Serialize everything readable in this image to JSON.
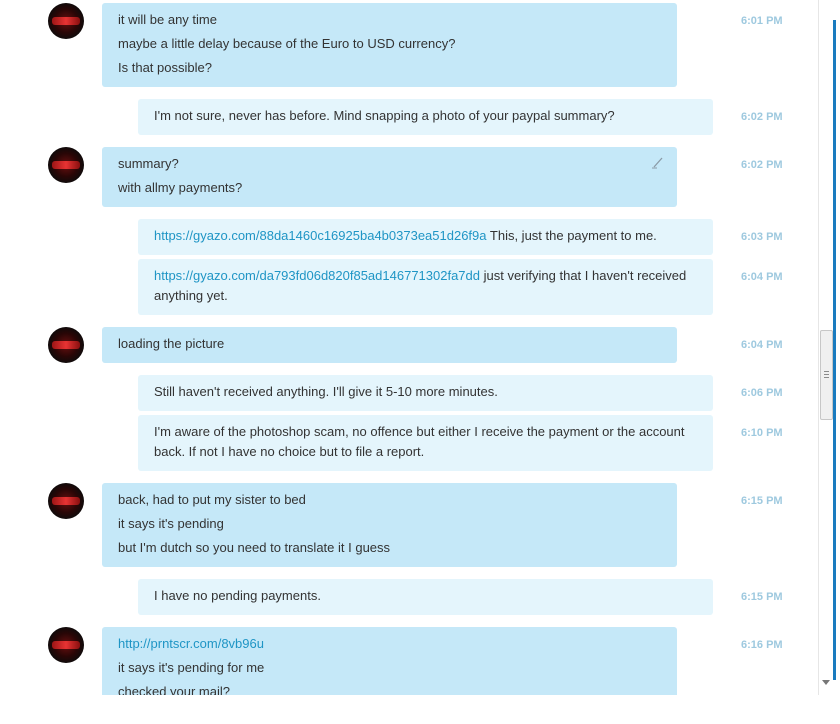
{
  "messages": [
    {
      "sender": "them",
      "lines": [
        {
          "text": "it will be any time"
        },
        {
          "text": "maybe a little delay because of the Euro to USD currency?"
        },
        {
          "text": "Is that possible?"
        }
      ],
      "time": "6:01 PM"
    },
    {
      "sender": "me",
      "lines": [
        {
          "text": "I'm not sure, never has before. Mind snapping a photo of your paypal summary?"
        }
      ],
      "time": "6:02 PM"
    },
    {
      "sender": "them",
      "lines": [
        {
          "text": "summary?"
        },
        {
          "text": "with allmy payments?"
        }
      ],
      "time": "6:02 PM",
      "edited": true
    },
    {
      "sender": "me",
      "lines": [
        {
          "link": "https://gyazo.com/88da1460c16925ba4b0373ea51d26f9a",
          "text": " This, just the payment to me."
        }
      ],
      "time": "6:03 PM"
    },
    {
      "sender": "me",
      "lines": [
        {
          "link": "https://gyazo.com/da793fd06d820f85ad146771302fa7dd",
          "text": " just verifying that I haven't received anything yet."
        }
      ],
      "time": "6:04 PM"
    },
    {
      "sender": "them",
      "lines": [
        {
          "text": "loading the picture"
        }
      ],
      "time": "6:04 PM"
    },
    {
      "sender": "me",
      "lines": [
        {
          "text": "Still haven't received anything. I'll give it 5-10 more minutes."
        }
      ],
      "time": "6:06 PM"
    },
    {
      "sender": "me",
      "lines": [
        {
          "text": "I'm aware of the photoshop scam, no offence but either I receive the payment or the account back. If not I have no choice but to file a report."
        }
      ],
      "time": "6:10 PM"
    },
    {
      "sender": "them",
      "lines": [
        {
          "text": "back, had to put my sister to bed"
        },
        {
          "text": "it says it's pending"
        },
        {
          "text": "but I'm dutch so you need to translate it I guess"
        }
      ],
      "time": "6:15 PM"
    },
    {
      "sender": "me",
      "lines": [
        {
          "text": "I have no pending payments."
        }
      ],
      "time": "6:15 PM"
    },
    {
      "sender": "them",
      "lines": [
        {
          "link": "http://prntscr.com/8vb96u"
        },
        {
          "text": "it says it's pending for me"
        },
        {
          "text": "checked your mail?"
        }
      ],
      "time": "6:16 PM"
    }
  ],
  "icons": {
    "avatar": "avatar-image",
    "edit": "pencil-icon",
    "scroll_grip": "grip-icon",
    "scroll_down": "chevron-down-icon"
  },
  "colors": {
    "them_bubble": "#c5e8f8",
    "me_bubble": "#e4f5fc",
    "link": "#1f95c5",
    "timestamp": "#9ec9df"
  }
}
